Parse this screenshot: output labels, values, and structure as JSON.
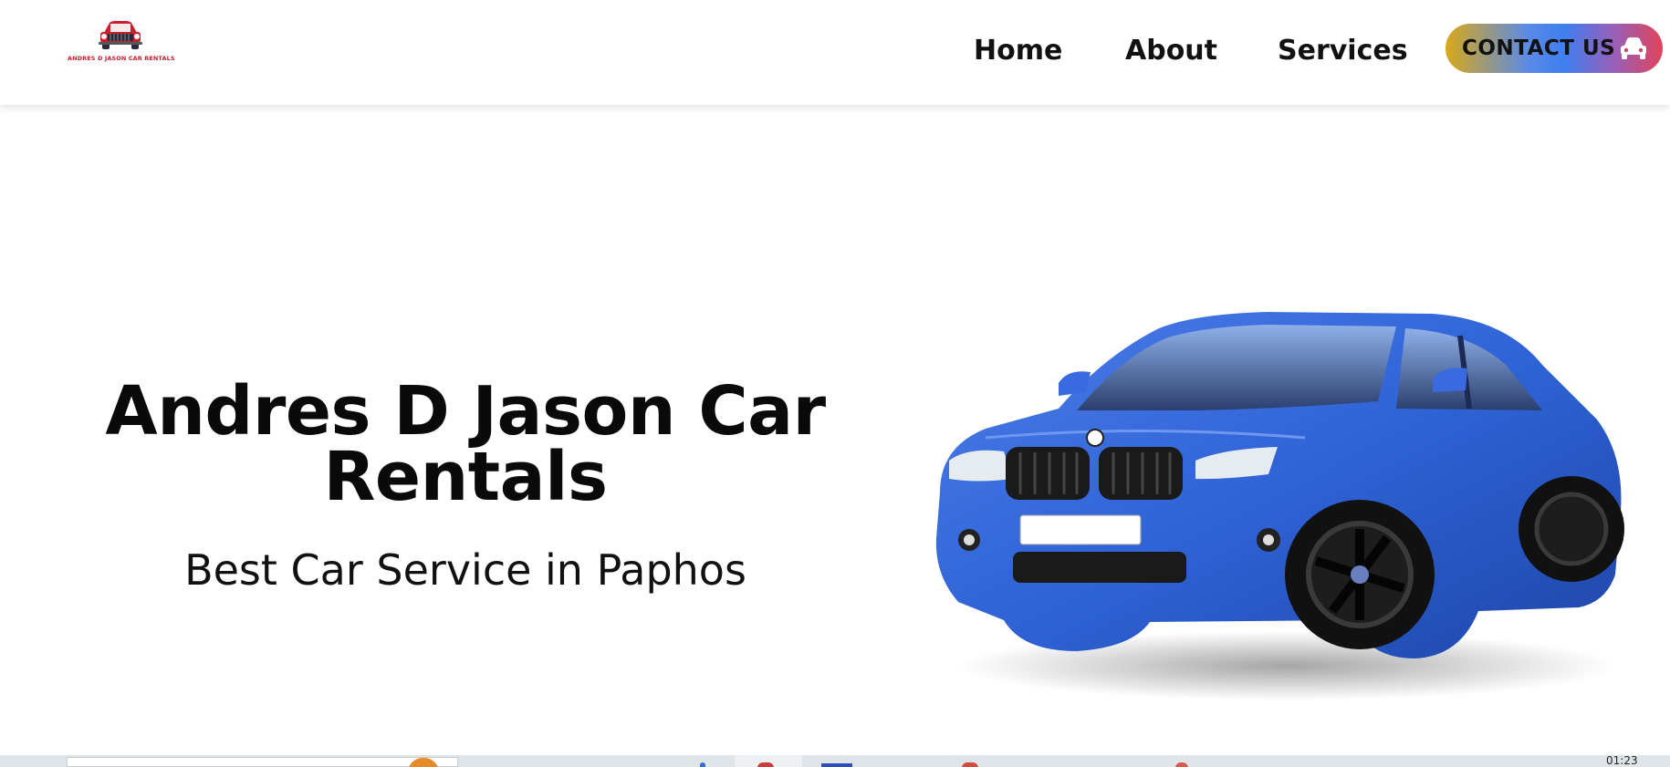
{
  "header": {
    "logo_text": "ANDRES D JASON CAR RENTALS",
    "logo_icon": "car-logo-icon"
  },
  "nav": {
    "items": [
      {
        "label": "Home"
      },
      {
        "label": "About"
      },
      {
        "label": "Services"
      }
    ],
    "contact_label": "CONTACT US",
    "contact_icon": "car-icon"
  },
  "hero": {
    "title": "Andres D Jason Car Rentals",
    "subtitle": "Best Car Service in Paphos",
    "image": "blue-hatchback-car"
  },
  "taskbar": {
    "clock": "01:23"
  },
  "colors": {
    "brand_red": "#c8202f",
    "car_blue": "#2f63d6",
    "contact_gradient_start": "#d9a81a",
    "contact_gradient_mid": "#3f7ef0",
    "contact_gradient_end": "#e04459"
  }
}
